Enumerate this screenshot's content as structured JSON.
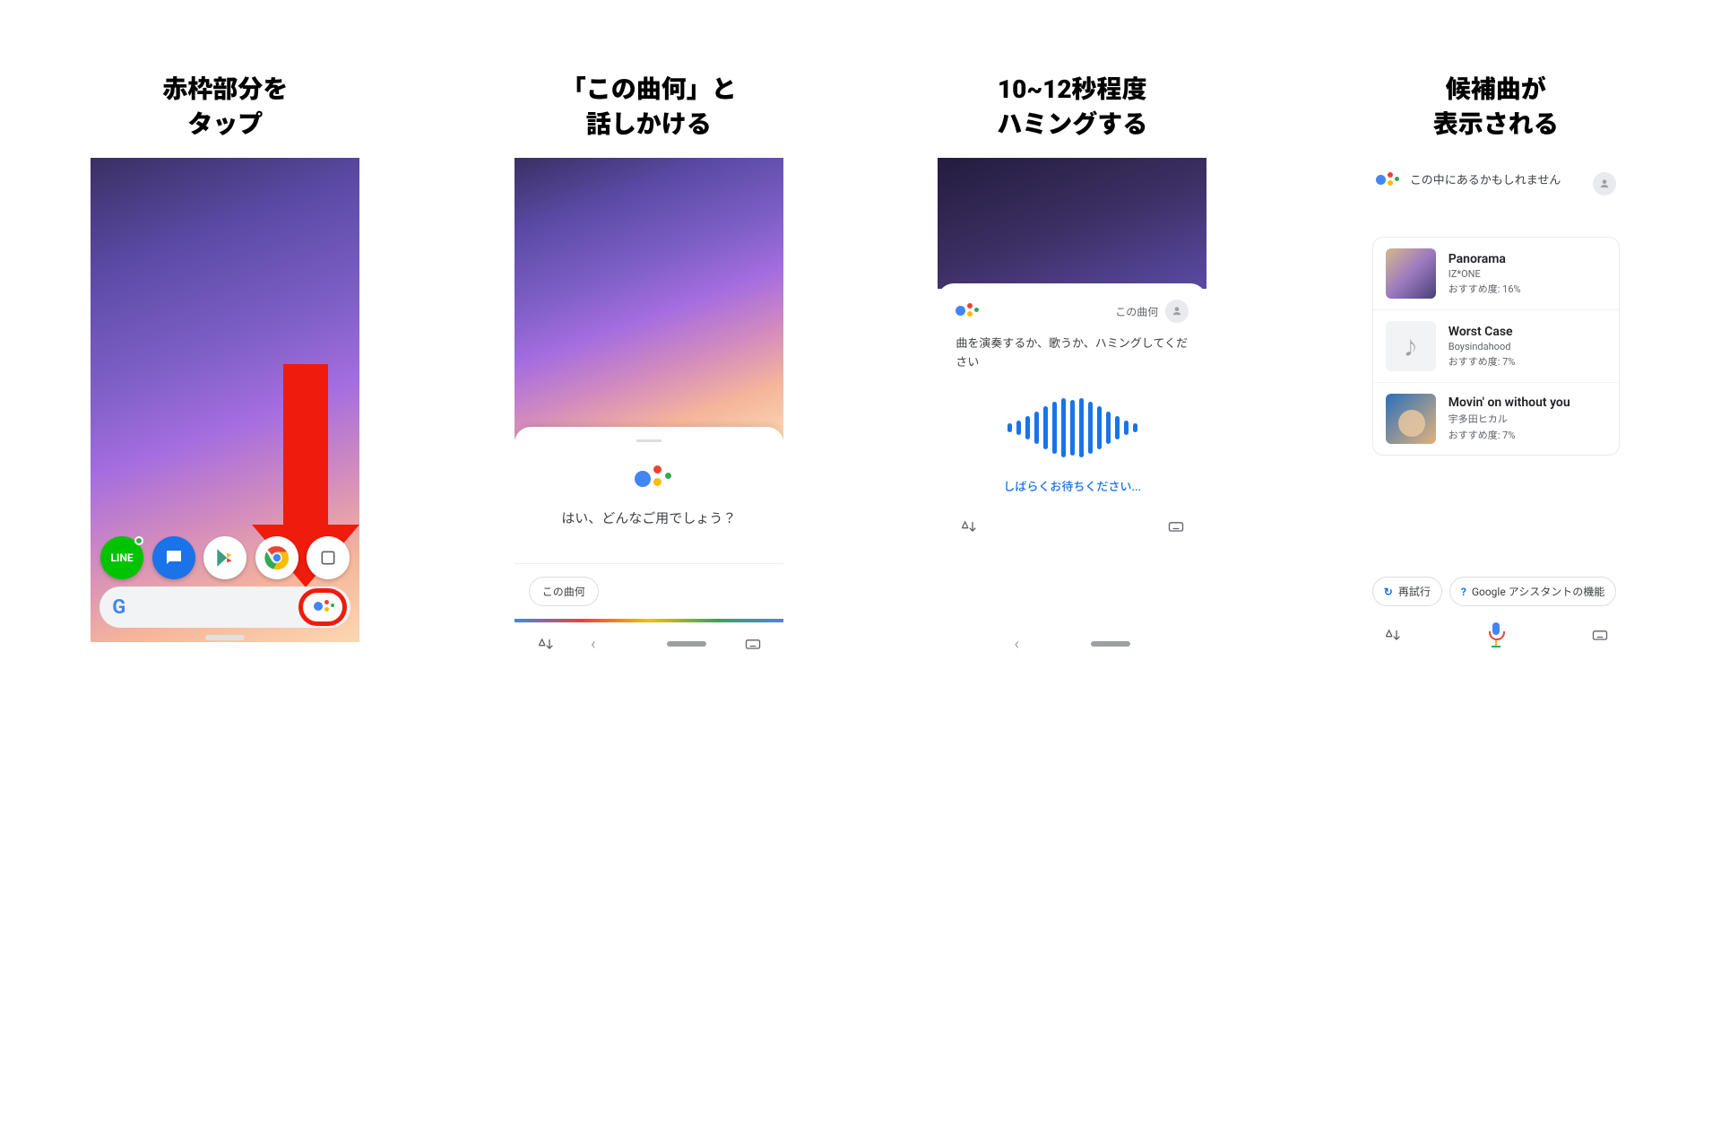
{
  "steps": [
    {
      "title_l1": "赤枠部分を",
      "title_l2": "タップ"
    },
    {
      "title_l1": "「この曲何」と",
      "title_l2": "話しかける"
    },
    {
      "title_l1": "10~12秒程度",
      "title_l2": "ハミングする"
    },
    {
      "title_l1": "候補曲が",
      "title_l2": "表示される"
    }
  ],
  "step1": {
    "line_label": "LINE"
  },
  "step2": {
    "prompt": "はい、どんなご用でしょう？",
    "chip": "この曲何"
  },
  "step3": {
    "user_said": "この曲何",
    "instruction": "曲を演奏するか、歌うか、ハミングしてください",
    "waiting": "しばらくお待ちください..."
  },
  "step4": {
    "message": "この中にあるかもしれません",
    "score_prefix": "おすすめ度: ",
    "results": [
      {
        "title": "Panorama",
        "artist": "IZ*ONE",
        "score": "16%"
      },
      {
        "title": "Worst Case",
        "artist": "Boysindahood",
        "score": "7%"
      },
      {
        "title": "Movin' on without you",
        "artist": "宇多田ヒカル",
        "score": "7%"
      }
    ],
    "retry": "再試行",
    "features": "Google アシスタントの機能"
  }
}
